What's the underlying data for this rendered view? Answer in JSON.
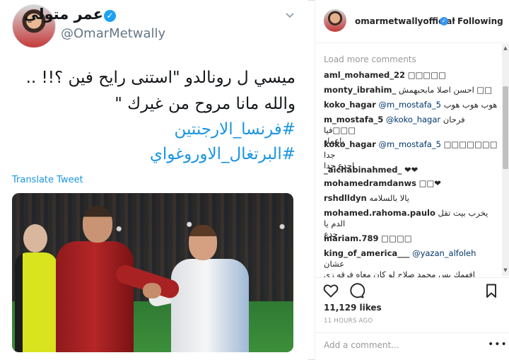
{
  "tweet": {
    "display_name": "عمر متولي",
    "handle": "@OmarMetwally",
    "text_line1": "ميسي ل رونالدو   \"استنى رايح فين ؟!! ..",
    "text_line2": "والله مانا مروح من غيرك \"",
    "hashtag1": "#فرنسا_الارجنتين",
    "hashtag2": "#البرتغال_الاوروغواي",
    "translate_label": "Translate Tweet"
  },
  "instagram": {
    "username": "omarmetwallyofficial",
    "following_label": "Following",
    "load_more": "Load more comments",
    "comments": [
      {
        "user": "aml_mohamed_22",
        "text": "□□□□□"
      },
      {
        "user": "monty_ibrahim_",
        "text": "احسن اصلا مابحبهمش □□"
      },
      {
        "user": "koko_hagar",
        "mention": "@m_mostafa_5",
        "text": "هوب هوب هوب"
      },
      {
        "user": "m_mostafa_5",
        "mention": "@koko_hagar",
        "text": "فرحان فيا□□□",
        "text2": "ياعماد"
      },
      {
        "user": "koko_hagar",
        "mention": "@m_mostafa_5",
        "text": "□□□□□□□ جدا",
        "text2": "اجدع جدا"
      },
      {
        "user": "_aichabinahmed_",
        "text": "❤❤"
      },
      {
        "user": "mohamedramdanws",
        "text": "□□❤"
      },
      {
        "user": "rshdlldyn",
        "text": "يالا بالسلامه"
      },
      {
        "user": "mohamed.rahoma.paulo",
        "text": "يخرب بيت تقل الدم يا",
        "text2": "جدع"
      },
      {
        "user": "mariam.789",
        "text": "□□□□"
      },
      {
        "user": "king_of_america___",
        "mention": "@yazan_alfoleh",
        "text": "عشان",
        "text2": "افهمك بس محمد صلاح لو كان معاه فرقه زي برتغال او"
      }
    ],
    "likes": "11,129 likes",
    "time_ago": "11 HOURS AGO",
    "add_comment_placeholder": "Add a comment..."
  }
}
